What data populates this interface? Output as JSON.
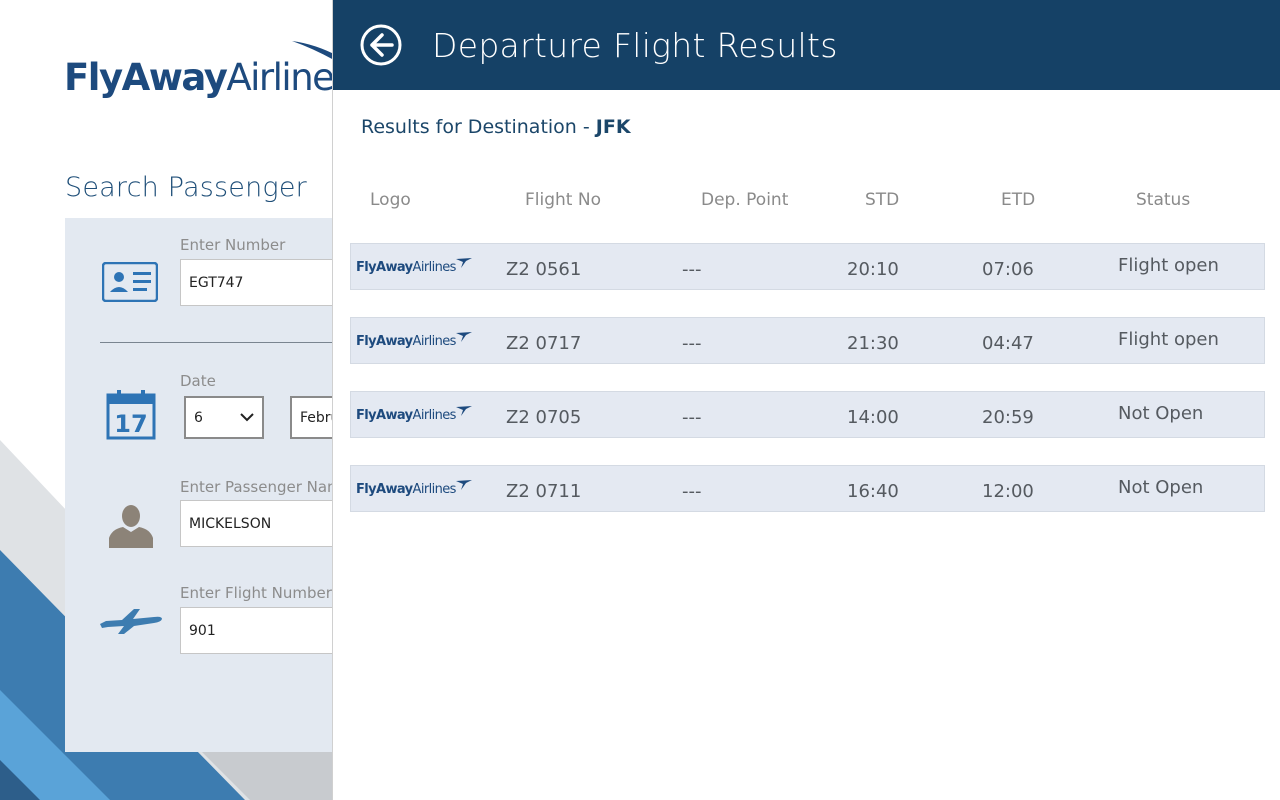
{
  "app": {
    "brand_part1": "FlyAway",
    "brand_part2": "Airlines",
    "colors": {
      "header": "#154166",
      "accent": "#1d4a7e",
      "panel": "#e3e9f1",
      "row": "#e4e9f2"
    }
  },
  "search": {
    "title": "Search Passenger",
    "number_label": "Enter Number",
    "number_value": "EGT747",
    "number_icon": "id-card-icon",
    "date_label": "Date",
    "date_day": "6",
    "date_month": "Febru",
    "date_icon": "calendar-icon",
    "calendar_day": "17",
    "passenger_label": "Enter Passenger Nam",
    "passenger_value": "MICKELSON",
    "passenger_icon": "person-icon",
    "flight_label": "Enter Flight Number",
    "flight_value": "901",
    "flight_icon": "airplane-icon"
  },
  "results": {
    "title": "Departure Flight Results",
    "subtitle_prefix": "Results for Destination - ",
    "destination": "JFK",
    "columns": {
      "logo": "Logo",
      "flight_no": "Flight No",
      "dep_point": "Dep. Point",
      "std": "STD",
      "etd": "ETD",
      "status": "Status"
    },
    "rows": [
      {
        "logo_part1": "FlyAway",
        "logo_part2": "Airlines",
        "flight_no": "Z2 0561",
        "dep_point": "---",
        "std": "20:10",
        "etd": "07:06",
        "status": "Flight open"
      },
      {
        "logo_part1": "FlyAway",
        "logo_part2": "Airlines",
        "flight_no": "Z2 0717",
        "dep_point": "---",
        "std": "21:30",
        "etd": "04:47",
        "status": "Flight open"
      },
      {
        "logo_part1": "FlyAway",
        "logo_part2": "Airlines",
        "flight_no": "Z2 0705",
        "dep_point": "---",
        "std": "14:00",
        "etd": "20:59",
        "status": "Not Open"
      },
      {
        "logo_part1": "FlyAway",
        "logo_part2": "Airlines",
        "flight_no": "Z2 0711",
        "dep_point": "---",
        "std": "16:40",
        "etd": "12:00",
        "status": "Not Open"
      }
    ]
  }
}
